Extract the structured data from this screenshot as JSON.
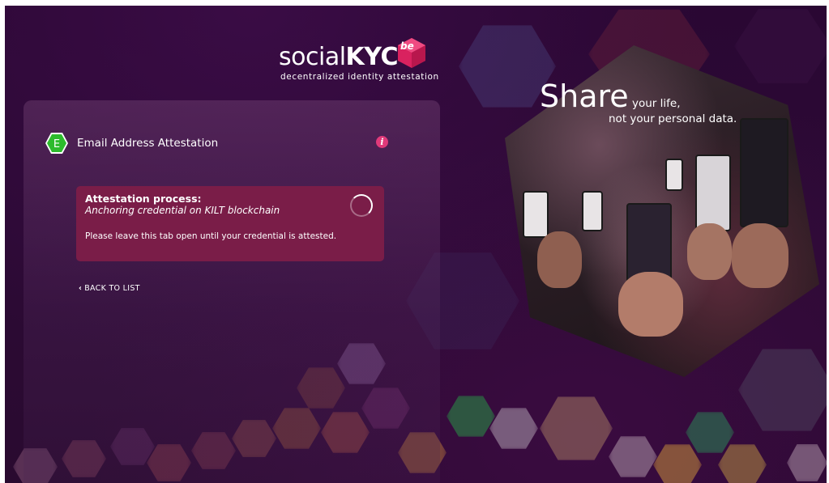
{
  "brand": {
    "name_light": "social",
    "name_bold": "KYC",
    "badge_text": "be",
    "tagline": "decentralized identity attestation",
    "accent_color": "#d9225f"
  },
  "card": {
    "badge_letter": "E",
    "badge_color": "#2dbb2d",
    "title": "Email Address Attestation",
    "info_icon": "i"
  },
  "process": {
    "heading": "Attestation process:",
    "status": "Anchoring credential on KILT blockchain",
    "note": "Please leave this tab open until your credential is attested.",
    "box_color": "#7a1d48"
  },
  "back_link": {
    "chevron": "‹",
    "label": "BACK TO LIST"
  },
  "hero": {
    "headline": "Share",
    "line1": "your life,",
    "line2": "not your personal data."
  }
}
